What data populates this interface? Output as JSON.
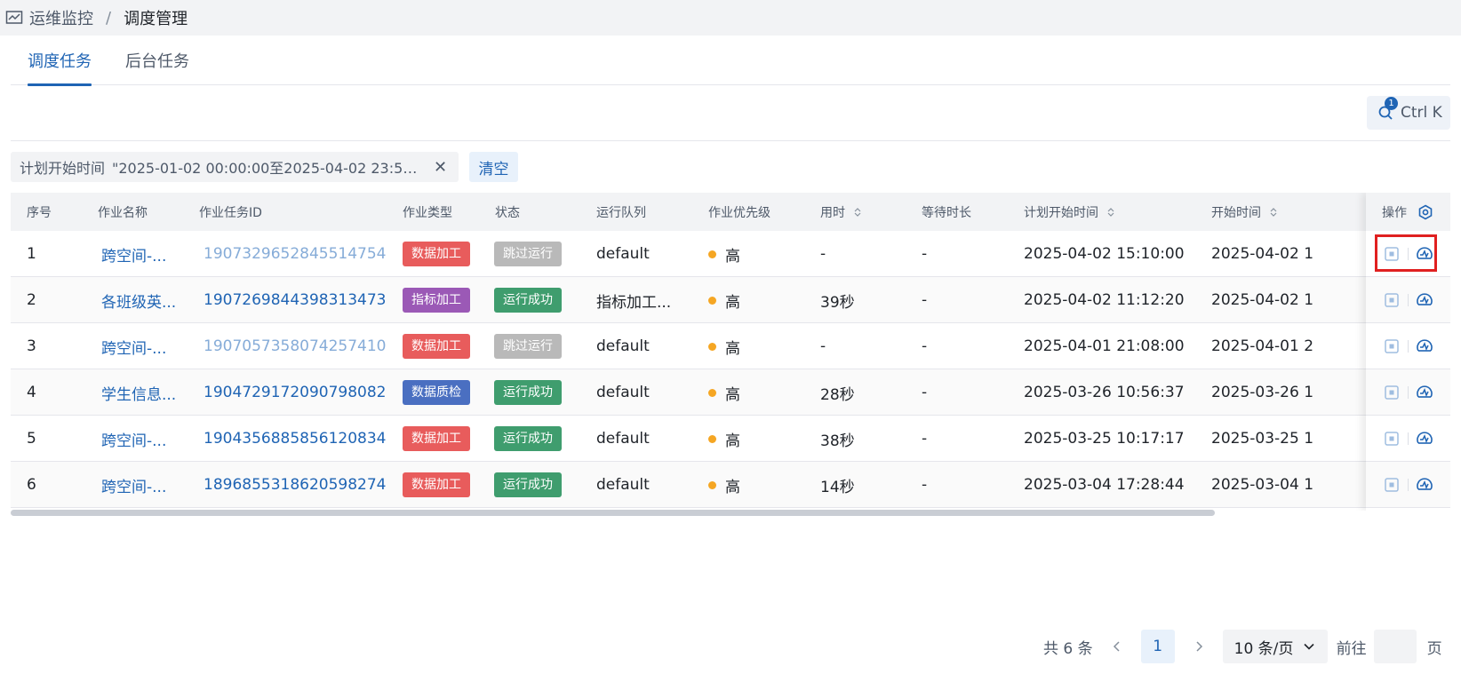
{
  "breadcrumb": {
    "parent": "运维监控",
    "separator": "/",
    "current": "调度管理",
    "icon": "chart-line-icon"
  },
  "tabs": [
    {
      "label": "调度任务",
      "active": true
    },
    {
      "label": "后台任务",
      "active": false
    }
  ],
  "search": {
    "shortcut": "Ctrl K",
    "badge": "1"
  },
  "filter": {
    "key": "计划开始时间",
    "value": "\"2025-01-02 00:00:00至2025-04-02 23:59:...",
    "clear_label": "清空"
  },
  "table": {
    "headers": {
      "index": "序号",
      "job_name": "作业名称",
      "task_id": "作业任务ID",
      "job_type": "作业类型",
      "status": "状态",
      "queue": "运行队列",
      "priority": "作业优先级",
      "duration": "用时",
      "wait": "等待时长",
      "planned_start": "计划开始时间",
      "start": "开始时间",
      "actions": "操作"
    },
    "rows": [
      {
        "index": "1",
        "job_name": "跨空间-...",
        "task_id": "1907329652845514754",
        "job_type": "数据加工",
        "status": "跳过运行",
        "queue": "default",
        "priority": "高",
        "duration": "-",
        "wait": "-",
        "planned_start": "2025-04-02 15:10:00",
        "start": "2025-04-02 1"
      },
      {
        "index": "2",
        "job_name": "各班级英...",
        "task_id": "1907269844398313473",
        "job_type": "指标加工",
        "status": "运行成功",
        "queue": "指标加工...",
        "priority": "高",
        "duration": "39秒",
        "wait": "-",
        "planned_start": "2025-04-02 11:12:20",
        "start": "2025-04-02 1"
      },
      {
        "index": "3",
        "job_name": "跨空间-...",
        "task_id": "1907057358074257410",
        "job_type": "数据加工",
        "status": "跳过运行",
        "queue": "default",
        "priority": "高",
        "duration": "-",
        "wait": "-",
        "planned_start": "2025-04-01 21:08:00",
        "start": "2025-04-01 2"
      },
      {
        "index": "4",
        "job_name": "学生信息...",
        "task_id": "1904729172090798082",
        "job_type": "数据质检",
        "status": "运行成功",
        "queue": "default",
        "priority": "高",
        "duration": "28秒",
        "wait": "-",
        "planned_start": "2025-03-26 10:56:37",
        "start": "2025-03-26 1"
      },
      {
        "index": "5",
        "job_name": "跨空间-...",
        "task_id": "1904356885856120834",
        "job_type": "数据加工",
        "status": "运行成功",
        "queue": "default",
        "priority": "高",
        "duration": "38秒",
        "wait": "-",
        "planned_start": "2025-03-25 10:17:17",
        "start": "2025-03-25 1"
      },
      {
        "index": "6",
        "job_name": "跨空间-...",
        "task_id": "1896855318620598274",
        "job_type": "数据加工",
        "status": "运行成功",
        "queue": "default",
        "priority": "高",
        "duration": "14秒",
        "wait": "-",
        "planned_start": "2025-03-04 17:28:44",
        "start": "2025-03-04 1"
      }
    ]
  },
  "colors": {
    "primary": "#1f64b4",
    "type_data_process": "#e85c5c",
    "type_metric_process": "#9b59b6",
    "type_data_quality": "#4a6fc1",
    "status_success": "#3f9d6e",
    "status_skipped": "#b9b9b9",
    "priority_high": "#f5a623",
    "highlight": "#e02020"
  },
  "pagination": {
    "total": "共 6 条",
    "current_page": "1",
    "page_size": "10 条/页",
    "goto_prefix": "前往",
    "goto_suffix": "页"
  }
}
